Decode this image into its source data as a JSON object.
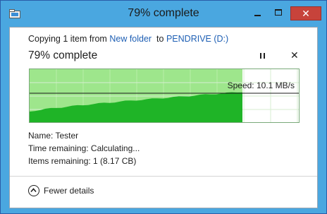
{
  "window": {
    "title": "79% complete",
    "close_glyph": "✕",
    "icon": "file-copy-icon"
  },
  "header": {
    "copy_prefix": "Copying 1 item from",
    "source": "New folder",
    "to_word": "to",
    "destination": "PENDRIVE (D:)",
    "progress_text": "79% complete"
  },
  "controls": {
    "pause_icon": "pause-icon",
    "cancel_glyph": "✕"
  },
  "graph": {
    "progress": 0.79,
    "speed_text": "Speed: 10.1 MB/s",
    "colors": {
      "done_bg": "#9ee68c",
      "remaining_bg": "#ffffff",
      "area": "#1fb427",
      "grid": "#bfe8b5",
      "speed_line": "#1a1a1a"
    }
  },
  "details": {
    "name": "Name: Tester",
    "time_remaining": "Time remaining: Calculating...",
    "items_remaining": "Items remaining: 1 (8.17 CB)"
  },
  "footer": {
    "fewer_details": "Fewer details"
  }
}
